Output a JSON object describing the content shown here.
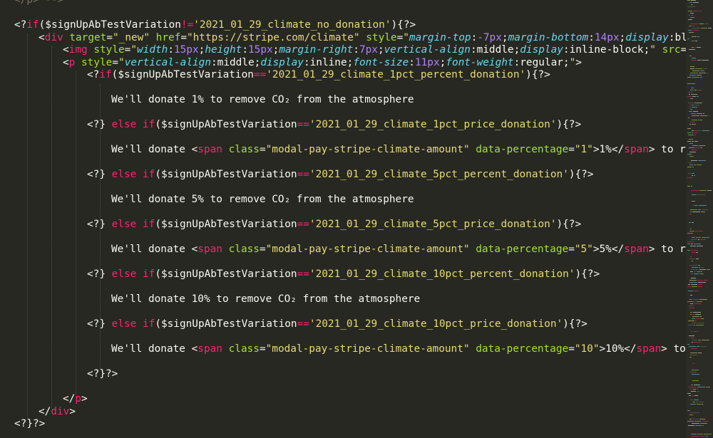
{
  "editor": {
    "theme": "monokai",
    "colors": {
      "background": "#272822",
      "text": "#f8f8f2",
      "keyword": "#f92672",
      "string": "#e6db74",
      "attribute": "#a6e22e",
      "property": "#66d9ef",
      "number": "#ae81ff",
      "comment": "#75715e"
    },
    "lines": [
      {
        "indent": 0,
        "tokens": [
          [
            "</p> -->",
            "c-cmt"
          ]
        ]
      },
      {
        "indent": 0,
        "tokens": []
      },
      {
        "indent": 0,
        "tokens": [
          [
            "<?",
            "c-text"
          ],
          [
            "if",
            "c-kw"
          ],
          [
            "($signUpAbTestVariation",
            "c-text"
          ],
          [
            "!=",
            "c-kw"
          ],
          [
            "'2021_01_29_climate_no_donation'",
            "c-str"
          ],
          [
            "){?>",
            "c-text"
          ]
        ]
      },
      {
        "indent": 1,
        "tokens": [
          [
            "<",
            "c-text"
          ],
          [
            "div",
            "c-kw"
          ],
          [
            " ",
            "c-text"
          ],
          [
            "target",
            "c-attr"
          ],
          [
            "=",
            "c-text"
          ],
          [
            "\"_new\"",
            "c-str"
          ],
          [
            " ",
            "c-text"
          ],
          [
            "href",
            "c-attr"
          ],
          [
            "=",
            "c-text"
          ],
          [
            "\"https://stripe.com/climate\"",
            "c-str"
          ],
          [
            " ",
            "c-text"
          ],
          [
            "style",
            "c-attr"
          ],
          [
            "=",
            "c-text"
          ],
          [
            "\"",
            "c-str"
          ],
          [
            "margin-top",
            "c-prop"
          ],
          [
            ":",
            "c-text"
          ],
          [
            "-7px",
            "c-num"
          ],
          [
            ";",
            "c-text"
          ],
          [
            "margin-bottom",
            "c-prop"
          ],
          [
            ":",
            "c-text"
          ],
          [
            "14px",
            "c-num"
          ],
          [
            ";",
            "c-text"
          ],
          [
            "display",
            "c-prop"
          ],
          [
            ":",
            "c-text"
          ],
          [
            "bl",
            "c-text"
          ]
        ]
      },
      {
        "indent": 2,
        "tokens": [
          [
            "<",
            "c-text"
          ],
          [
            "img",
            "c-kw"
          ],
          [
            " ",
            "c-text"
          ],
          [
            "style",
            "c-attr"
          ],
          [
            "=",
            "c-text"
          ],
          [
            "\"",
            "c-str"
          ],
          [
            "width",
            "c-prop"
          ],
          [
            ":",
            "c-text"
          ],
          [
            "15px",
            "c-num"
          ],
          [
            ";",
            "c-text"
          ],
          [
            "height",
            "c-prop"
          ],
          [
            ":",
            "c-text"
          ],
          [
            "15px",
            "c-num"
          ],
          [
            ";",
            "c-text"
          ],
          [
            "margin-right",
            "c-prop"
          ],
          [
            ":",
            "c-text"
          ],
          [
            "7px",
            "c-num"
          ],
          [
            ";",
            "c-text"
          ],
          [
            "vertical-align",
            "c-prop"
          ],
          [
            ":",
            "c-text"
          ],
          [
            "middle",
            "c-text"
          ],
          [
            ";",
            "c-text"
          ],
          [
            "display",
            "c-prop"
          ],
          [
            ":",
            "c-text"
          ],
          [
            "inline-block",
            "c-text"
          ],
          [
            ";",
            "c-text"
          ],
          [
            "\"",
            "c-str"
          ],
          [
            " ",
            "c-text"
          ],
          [
            "src",
            "c-attr"
          ],
          [
            "=",
            "c-text"
          ]
        ]
      },
      {
        "indent": 2,
        "tokens": [
          [
            "<",
            "c-text"
          ],
          [
            "p",
            "c-kw"
          ],
          [
            " ",
            "c-text"
          ],
          [
            "style",
            "c-attr"
          ],
          [
            "=",
            "c-text"
          ],
          [
            "\"",
            "c-str"
          ],
          [
            "vertical-align",
            "c-prop"
          ],
          [
            ":",
            "c-text"
          ],
          [
            "middle",
            "c-text"
          ],
          [
            ";",
            "c-text"
          ],
          [
            "display",
            "c-prop"
          ],
          [
            ":",
            "c-text"
          ],
          [
            "inline",
            "c-text"
          ],
          [
            ";",
            "c-text"
          ],
          [
            "font-size",
            "c-prop"
          ],
          [
            ":",
            "c-text"
          ],
          [
            "11px",
            "c-num"
          ],
          [
            ";",
            "c-text"
          ],
          [
            "font-weight",
            "c-prop"
          ],
          [
            ":",
            "c-text"
          ],
          [
            "regular",
            "c-text"
          ],
          [
            ";",
            "c-text"
          ],
          [
            "\"",
            "c-str"
          ],
          [
            ">",
            "c-text"
          ]
        ]
      },
      {
        "indent": 3,
        "tokens": [
          [
            "<?",
            "c-text"
          ],
          [
            "if",
            "c-kw"
          ],
          [
            "($signUpAbTestVariation",
            "c-text"
          ],
          [
            "==",
            "c-kw"
          ],
          [
            "'2021_01_29_climate_1pct_percent_donation'",
            "c-str"
          ],
          [
            "){?>",
            "c-text"
          ]
        ]
      },
      {
        "indent": 0,
        "tokens": []
      },
      {
        "indent": 4,
        "tokens": [
          [
            "We'll donate 1% to remove CO₂ from the atmosphere",
            "c-text"
          ]
        ]
      },
      {
        "indent": 0,
        "tokens": []
      },
      {
        "indent": 3,
        "tokens": [
          [
            "<?} ",
            "c-text"
          ],
          [
            "else",
            "c-kw"
          ],
          [
            " ",
            "c-text"
          ],
          [
            "if",
            "c-kw"
          ],
          [
            "($signUpAbTestVariation",
            "c-text"
          ],
          [
            "==",
            "c-kw"
          ],
          [
            "'2021_01_29_climate_1pct_price_donation'",
            "c-str"
          ],
          [
            "){?>",
            "c-text"
          ]
        ]
      },
      {
        "indent": 0,
        "tokens": []
      },
      {
        "indent": 4,
        "tokens": [
          [
            "We'll donate <",
            "c-text"
          ],
          [
            "span",
            "c-kw"
          ],
          [
            " ",
            "c-text"
          ],
          [
            "class",
            "c-attr"
          ],
          [
            "=",
            "c-text"
          ],
          [
            "\"modal-pay-stripe-climate-amount\"",
            "c-str"
          ],
          [
            " ",
            "c-text"
          ],
          [
            "data-percentage",
            "c-attr"
          ],
          [
            "=",
            "c-text"
          ],
          [
            "\"1\"",
            "c-str"
          ],
          [
            ">1%</",
            "c-text"
          ],
          [
            "span",
            "c-kw"
          ],
          [
            "> to r",
            "c-text"
          ]
        ]
      },
      {
        "indent": 0,
        "tokens": []
      },
      {
        "indent": 3,
        "tokens": [
          [
            "<?} ",
            "c-text"
          ],
          [
            "else",
            "c-kw"
          ],
          [
            " ",
            "c-text"
          ],
          [
            "if",
            "c-kw"
          ],
          [
            "($signUpAbTestVariation",
            "c-text"
          ],
          [
            "==",
            "c-kw"
          ],
          [
            "'2021_01_29_climate_5pct_percent_donation'",
            "c-str"
          ],
          [
            "){?>",
            "c-text"
          ]
        ]
      },
      {
        "indent": 0,
        "tokens": []
      },
      {
        "indent": 4,
        "tokens": [
          [
            "We'll donate 5% to remove CO₂ from the atmosphere",
            "c-text"
          ]
        ]
      },
      {
        "indent": 0,
        "tokens": []
      },
      {
        "indent": 3,
        "tokens": [
          [
            "<?} ",
            "c-text"
          ],
          [
            "else",
            "c-kw"
          ],
          [
            " ",
            "c-text"
          ],
          [
            "if",
            "c-kw"
          ],
          [
            "($signUpAbTestVariation",
            "c-text"
          ],
          [
            "==",
            "c-kw"
          ],
          [
            "'2021_01_29_climate_5pct_price_donation'",
            "c-str"
          ],
          [
            "){?>",
            "c-text"
          ]
        ]
      },
      {
        "indent": 0,
        "tokens": []
      },
      {
        "indent": 4,
        "tokens": [
          [
            "We'll donate <",
            "c-text"
          ],
          [
            "span",
            "c-kw"
          ],
          [
            " ",
            "c-text"
          ],
          [
            "class",
            "c-attr"
          ],
          [
            "=",
            "c-text"
          ],
          [
            "\"modal-pay-stripe-climate-amount\"",
            "c-str"
          ],
          [
            " ",
            "c-text"
          ],
          [
            "data-percentage",
            "c-attr"
          ],
          [
            "=",
            "c-text"
          ],
          [
            "\"5\"",
            "c-str"
          ],
          [
            ">5%</",
            "c-text"
          ],
          [
            "span",
            "c-kw"
          ],
          [
            "> to r",
            "c-text"
          ]
        ]
      },
      {
        "indent": 0,
        "tokens": []
      },
      {
        "indent": 3,
        "tokens": [
          [
            "<?} ",
            "c-text"
          ],
          [
            "else",
            "c-kw"
          ],
          [
            " ",
            "c-text"
          ],
          [
            "if",
            "c-kw"
          ],
          [
            "($signUpAbTestVariation",
            "c-text"
          ],
          [
            "==",
            "c-kw"
          ],
          [
            "'2021_01_29_climate_10pct_percent_donation'",
            "c-str"
          ],
          [
            "){?>",
            "c-text"
          ]
        ]
      },
      {
        "indent": 0,
        "tokens": []
      },
      {
        "indent": 4,
        "tokens": [
          [
            "We'll donate 10% to remove CO₂ from the atmosphere",
            "c-text"
          ]
        ]
      },
      {
        "indent": 0,
        "tokens": []
      },
      {
        "indent": 3,
        "tokens": [
          [
            "<?} ",
            "c-text"
          ],
          [
            "else",
            "c-kw"
          ],
          [
            " ",
            "c-text"
          ],
          [
            "if",
            "c-kw"
          ],
          [
            "($signUpAbTestVariation",
            "c-text"
          ],
          [
            "==",
            "c-kw"
          ],
          [
            "'2021_01_29_climate_10pct_price_donation'",
            "c-str"
          ],
          [
            "){?>",
            "c-text"
          ]
        ]
      },
      {
        "indent": 0,
        "tokens": []
      },
      {
        "indent": 4,
        "tokens": [
          [
            "We'll donate <",
            "c-text"
          ],
          [
            "span",
            "c-kw"
          ],
          [
            " ",
            "c-text"
          ],
          [
            "class",
            "c-attr"
          ],
          [
            "=",
            "c-text"
          ],
          [
            "\"modal-pay-stripe-climate-amount\"",
            "c-str"
          ],
          [
            " ",
            "c-text"
          ],
          [
            "data-percentage",
            "c-attr"
          ],
          [
            "=",
            "c-text"
          ],
          [
            "\"10\"",
            "c-str"
          ],
          [
            ">10%</",
            "c-text"
          ],
          [
            "span",
            "c-kw"
          ],
          [
            "> to",
            "c-text"
          ]
        ]
      },
      {
        "indent": 0,
        "tokens": []
      },
      {
        "indent": 3,
        "tokens": [
          [
            "<?}?>",
            "c-text"
          ]
        ]
      },
      {
        "indent": 0,
        "tokens": []
      },
      {
        "indent": 2,
        "tokens": [
          [
            "</",
            "c-text"
          ],
          [
            "p",
            "c-kw"
          ],
          [
            ">",
            "c-text"
          ]
        ]
      },
      {
        "indent": 1,
        "tokens": [
          [
            "</",
            "c-text"
          ],
          [
            "div",
            "c-kw"
          ],
          [
            ">",
            "c-text"
          ]
        ]
      },
      {
        "indent": 0,
        "tokens": [
          [
            "<?}?>",
            "c-text"
          ]
        ]
      }
    ]
  }
}
